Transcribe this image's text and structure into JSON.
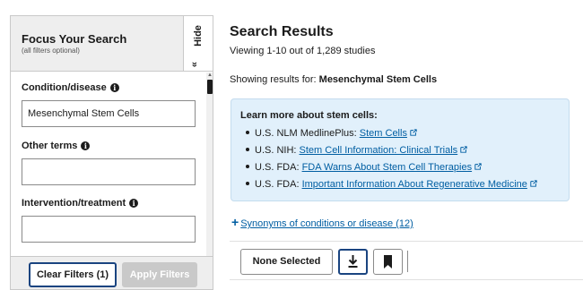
{
  "filters": {
    "title": "Focus Your Search",
    "subtitle": "(all filters optional)",
    "hide_label": "Hide",
    "hide_chevron": "«",
    "fields": [
      {
        "label": "Condition/disease",
        "value": "Mesenchymal Stem Cells",
        "placeholder": ""
      },
      {
        "label": "Other terms",
        "value": "",
        "placeholder": ""
      },
      {
        "label": "Intervention/treatment",
        "value": "",
        "placeholder": ""
      }
    ],
    "clear_button": "Clear Filters (1)",
    "apply_button": "Apply Filters"
  },
  "results": {
    "title": "Search Results",
    "count_text": "Viewing 1-10 out of 1,289 studies",
    "showing_prefix": "Showing results for: ",
    "showing_term": "Mesenchymal Stem Cells",
    "learn_more": {
      "title": "Learn more about stem cells:",
      "items": [
        {
          "prefix": "U.S. NLM MedlinePlus: ",
          "link": "Stem Cells"
        },
        {
          "prefix": "U.S. NIH: ",
          "link": "Stem Cell Information: Clinical Trials"
        },
        {
          "prefix": "U.S. FDA: ",
          "link": "FDA Warns About Stem Cell Therapies"
        },
        {
          "prefix": "U.S. FDA: ",
          "link": "Important Information About Regenerative Medicine"
        }
      ]
    },
    "synonyms_plus": "+",
    "synonyms_link": "Synonyms of conditions or disease (12)",
    "toolbar": {
      "none_selected": "None Selected"
    }
  },
  "colors": {
    "link": "#005ea2",
    "primary_border": "#1a4480",
    "info_box_bg": "#e1f0fb",
    "panel_bg": "#eeeeee",
    "disabled_button": "#c9c9c9"
  },
  "icons": [
    "info-icon",
    "external-link-icon",
    "download-icon",
    "bookmark-icon",
    "chevron-double-left-icon"
  ]
}
